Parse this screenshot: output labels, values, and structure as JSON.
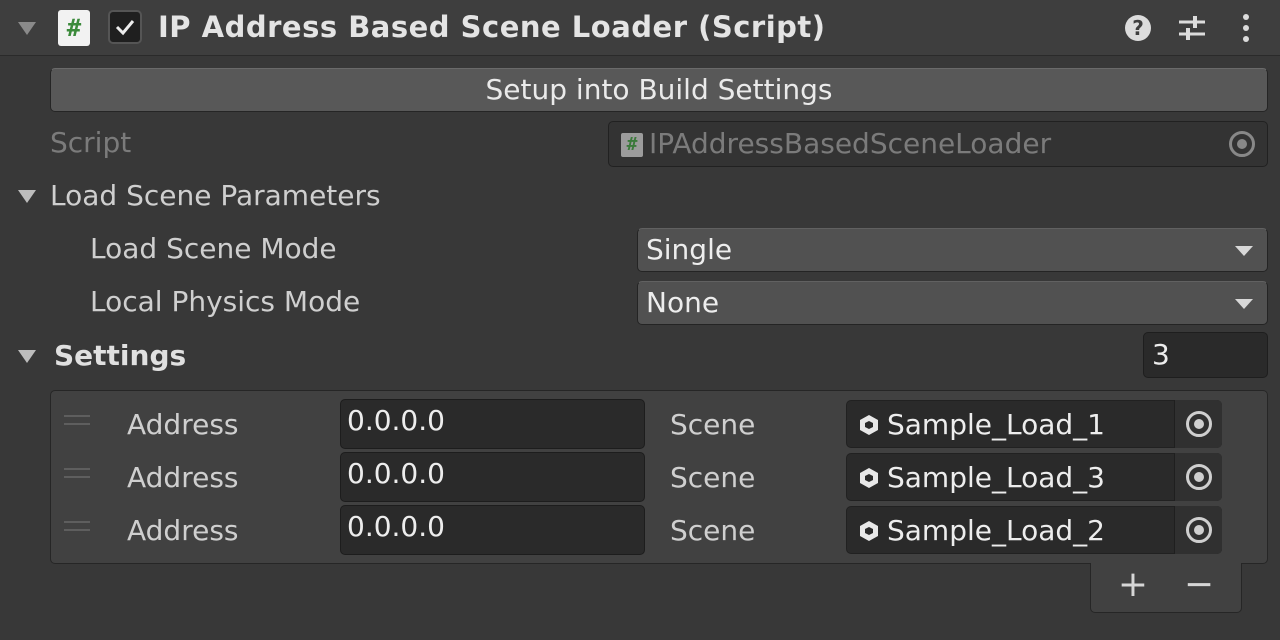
{
  "component": {
    "title": "IP Address Based Scene Loader (Script)",
    "enabled": true,
    "icons": [
      "help-icon",
      "preset-icon",
      "more-icon"
    ]
  },
  "setup_button": {
    "label": "Setup into Build Settings"
  },
  "script_field": {
    "label": "Script",
    "value": "IPAddressBasedSceneLoader"
  },
  "load_scene_parameters": {
    "label": "Load Scene Parameters",
    "load_scene_mode": {
      "label": "Load Scene Mode",
      "value": "Single"
    },
    "local_physics_mode": {
      "label": "Local Physics Mode",
      "value": "None"
    }
  },
  "settings": {
    "label": "Settings",
    "count": "3",
    "rows": [
      {
        "address_label": "Address",
        "address": "0.0.0.0",
        "scene_label": "Scene",
        "scene": "Sample_Load_1"
      },
      {
        "address_label": "Address",
        "address": "0.0.0.0",
        "scene_label": "Scene",
        "scene": "Sample_Load_3"
      },
      {
        "address_label": "Address",
        "address": "0.0.0.0",
        "scene_label": "Scene",
        "scene": "Sample_Load_2"
      }
    ],
    "add_label": "+",
    "remove_label": "−"
  }
}
